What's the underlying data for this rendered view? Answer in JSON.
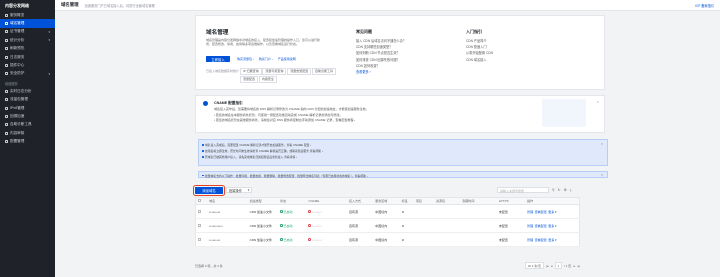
{
  "sidebar": {
    "brand": "内容分发网络",
    "items_top": [
      {
        "label": "服务概览",
        "active": false,
        "caret": ""
      },
      {
        "label": "域名管理",
        "active": true,
        "caret": ""
      },
      {
        "label": "证书管理",
        "active": false,
        "caret": "▾"
      },
      {
        "label": "统计分析",
        "active": false,
        "caret": "▾"
      },
      {
        "label": "刷新预热",
        "active": false,
        "caret": ""
      },
      {
        "label": "日志服务",
        "active": false,
        "caret": ""
      },
      {
        "label": "插件中心",
        "active": false,
        "caret": ""
      },
      {
        "label": "安全防护",
        "active": false,
        "caret": "▾"
      }
    ],
    "section_label": "增值服务",
    "items_bottom": [
      {
        "label": "实时日志分析"
      },
      {
        "label": "流量包管理"
      },
      {
        "label": "IPv6管理"
      },
      {
        "label": "回源加速"
      },
      {
        "label": "自助诊断工具"
      },
      {
        "label": "内容审核"
      },
      {
        "label": "配置管理"
      }
    ]
  },
  "topbar": {
    "title": "域名管理",
    "subtitle": "加速服务门户已域名接入后，将进行全面域名管理",
    "right_link": "ICP 备案指引"
  },
  "overview": {
    "title": "域名管理",
    "description": "域名管理是内容分发网络中对域名的接入、配置和加速管理的操作入口，您可以进行新增、配置修改、停用、启用等多项运维操作，以及查看域名运行状态。",
    "primary_button": "立即接入",
    "links": [
      "购买流量包 ›",
      "购买门户 ›",
      "产品使用说明"
    ],
    "products_label": "已接入域名数据实时统计",
    "chips": [
      "IP 归属查询",
      "流量可视查询",
      "流量告警配置",
      "自助诊断工具",
      "流量配置",
      "内容安全"
    ]
  },
  "faq": {
    "title": "常见问题",
    "items": [
      "接入 CDN 后域名访问不通怎么办？",
      "CDN 支持哪些加速类型？",
      "如何判断 CDN 节点是否生效？",
      "如何排查 CDN 回源失败问题？",
      "CDN 如何收费？",
      "查看更多 ›"
    ]
  },
  "guide": {
    "title": "入门指引",
    "items": [
      "CDN 产品简介",
      "CDN 快速入门",
      "从零开始配置 CDN",
      "CDN 域名接入"
    ]
  },
  "banner": {
    "title": "CNAME 配置指引",
    "intro": "域名接入完毕后，您需要将域名的 DNS 解析记录修改为 CNAME 指向 CDN 分配的加速地址，才能使加速服务生效。",
    "bullets": [
      "• 若您的域名在本服务商处托管，可使用一键配置功能自动完成 CNAME 解析记录的添加与修改。",
      "• 若您的域名托管在其他服务商处，请前往对应 DNS 服务商控制台手动添加 CNAME 记录，查看配置教程 ›"
    ]
  },
  "notices": [
    {
      "text": "域名接入完成后，需要配置 CNAME 解析记录才能开启加速服务，查看 CNAME 配置 ›"
    },
    {
      "text": "启用后将立即生效，若长时间未生效请检查 CNAME 解析是否正确，或联系售后服务 查看帮助 ›"
    },
    {
      "text": "若域名已被其他用户接入，请先完成域名归属权验证后重新接入 查看详情 ›"
    },
    {
      "text": "批量域名支持以下操作：批量停用、批量启用、批量删除、批量修改配置、批量导出域名列表（仅限已启用状态的域名）。查看帮助 ›"
    }
  ],
  "toolbar": {
    "add_button": "添加域名",
    "more_select": "批量操作",
    "search_placeholder": "请输入关键字搜索",
    "icons": [
      "filter-icon",
      "refresh-icon",
      "settings-icon",
      "download-icon"
    ]
  },
  "table": {
    "columns": [
      "域名",
      "加速类型",
      "状态",
      "CNAME",
      "接入方式",
      "服务区域",
      "标签",
      "项目",
      "资源包",
      "到期时间",
      "HTTPS",
      "操作"
    ],
    "rows": [
      {
        "domain": "•••••••••",
        "type": "CDN 加速小文件",
        "status": "已启动",
        "cname": "••••••••",
        "access": "自有源",
        "region": "中国境内",
        "https": "未配置",
        "ops": [
          "管理",
          "查看配置",
          "更多 ▾"
        ]
      },
      {
        "domain": "•••••••••••",
        "type": "CDN 加速小文件",
        "status": "已启动",
        "cname": "••••••••",
        "access": "自有源",
        "region": "中国境内",
        "https": "未配置",
        "ops": [
          "管理",
          "查看配置",
          "更多 ▾"
        ]
      },
      {
        "domain": "•••••••••",
        "type": "CDN 加速小文件",
        "status": "已启动",
        "cname": "••••••••",
        "access": "自有源",
        "region": "中国境内",
        "https": "未配置",
        "ops": [
          "管理",
          "查看配置",
          "更多 ▾"
        ]
      }
    ]
  },
  "footer": {
    "left": "已选择 0 项，共 3 条",
    "per_page": "20 ▾ 条/页",
    "page": "1",
    "total_pages": "/ 1 页"
  },
  "colors": {
    "accent": "#0052d9",
    "sidebar_bg": "#1f2329",
    "notice_bg": "#dfe9fb",
    "highlight": "#e8431f"
  }
}
